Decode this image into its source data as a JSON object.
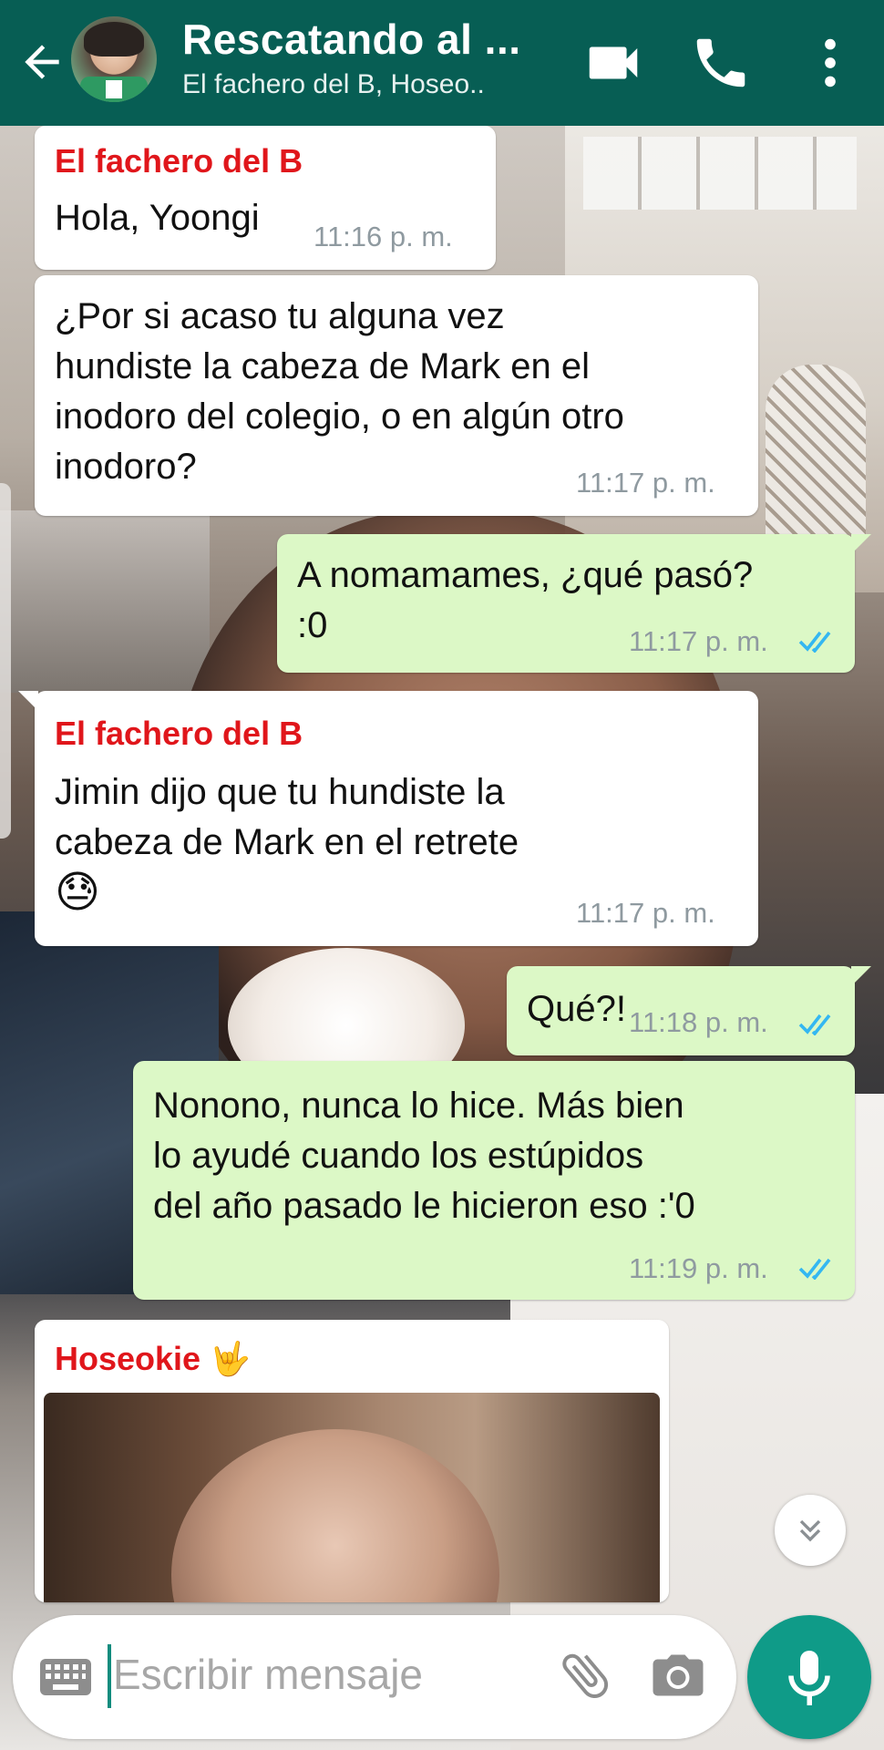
{
  "header": {
    "title": "Rescatando al ...",
    "subtitle": "El fachero del B, Hoseo..",
    "color": "#075e54"
  },
  "messages": [
    {
      "direction": "in",
      "sender": "El fachero del B",
      "lines": [
        "Hola, Yoongi"
      ],
      "time": "11:16 p. m."
    },
    {
      "direction": "in",
      "sender": "",
      "lines": [
        "¿Por si acaso tu alguna vez",
        "hundiste la cabeza de Mark en el",
        "inodoro del colegio, o en algún otro",
        "inodoro?"
      ],
      "time": "11:17 p. m."
    },
    {
      "direction": "out",
      "lines": [
        "A nomamames, ¿qué pasó?",
        ":0"
      ],
      "time": "11:17 p. m.",
      "status": "read"
    },
    {
      "direction": "in",
      "sender": "El fachero del B",
      "lines": [
        "Jimin dijo que tu hundiste la",
        "cabeza de Mark en el retrete",
        "😓"
      ],
      "time": "11:17 p. m."
    },
    {
      "direction": "out",
      "lines": [
        "Qué?!"
      ],
      "time": "11:18 p. m.",
      "status": "read"
    },
    {
      "direction": "out",
      "lines": [
        "Nonono, nunca lo hice. Más bien",
        "lo ayudé cuando los estúpidos",
        "del año pasado le hicieron eso :'0"
      ],
      "time": "11:19 p. m.",
      "status": "read"
    },
    {
      "direction": "in",
      "sender": "Hoseokie 🤟",
      "type": "image"
    }
  ],
  "input": {
    "placeholder": "Escribir mensaje"
  },
  "colors": {
    "sender": "#e0161b",
    "outgoing_bubble": "#dcf8c6",
    "read_ticks": "#34b7f1",
    "mic_button": "#0f9b88"
  },
  "icons": [
    "back-arrow-icon",
    "video-call-icon",
    "phone-icon",
    "more-vert-icon",
    "scroll-down-icon",
    "keyboard-icon",
    "attach-icon",
    "camera-icon",
    "mic-icon",
    "double-check-icon"
  ]
}
